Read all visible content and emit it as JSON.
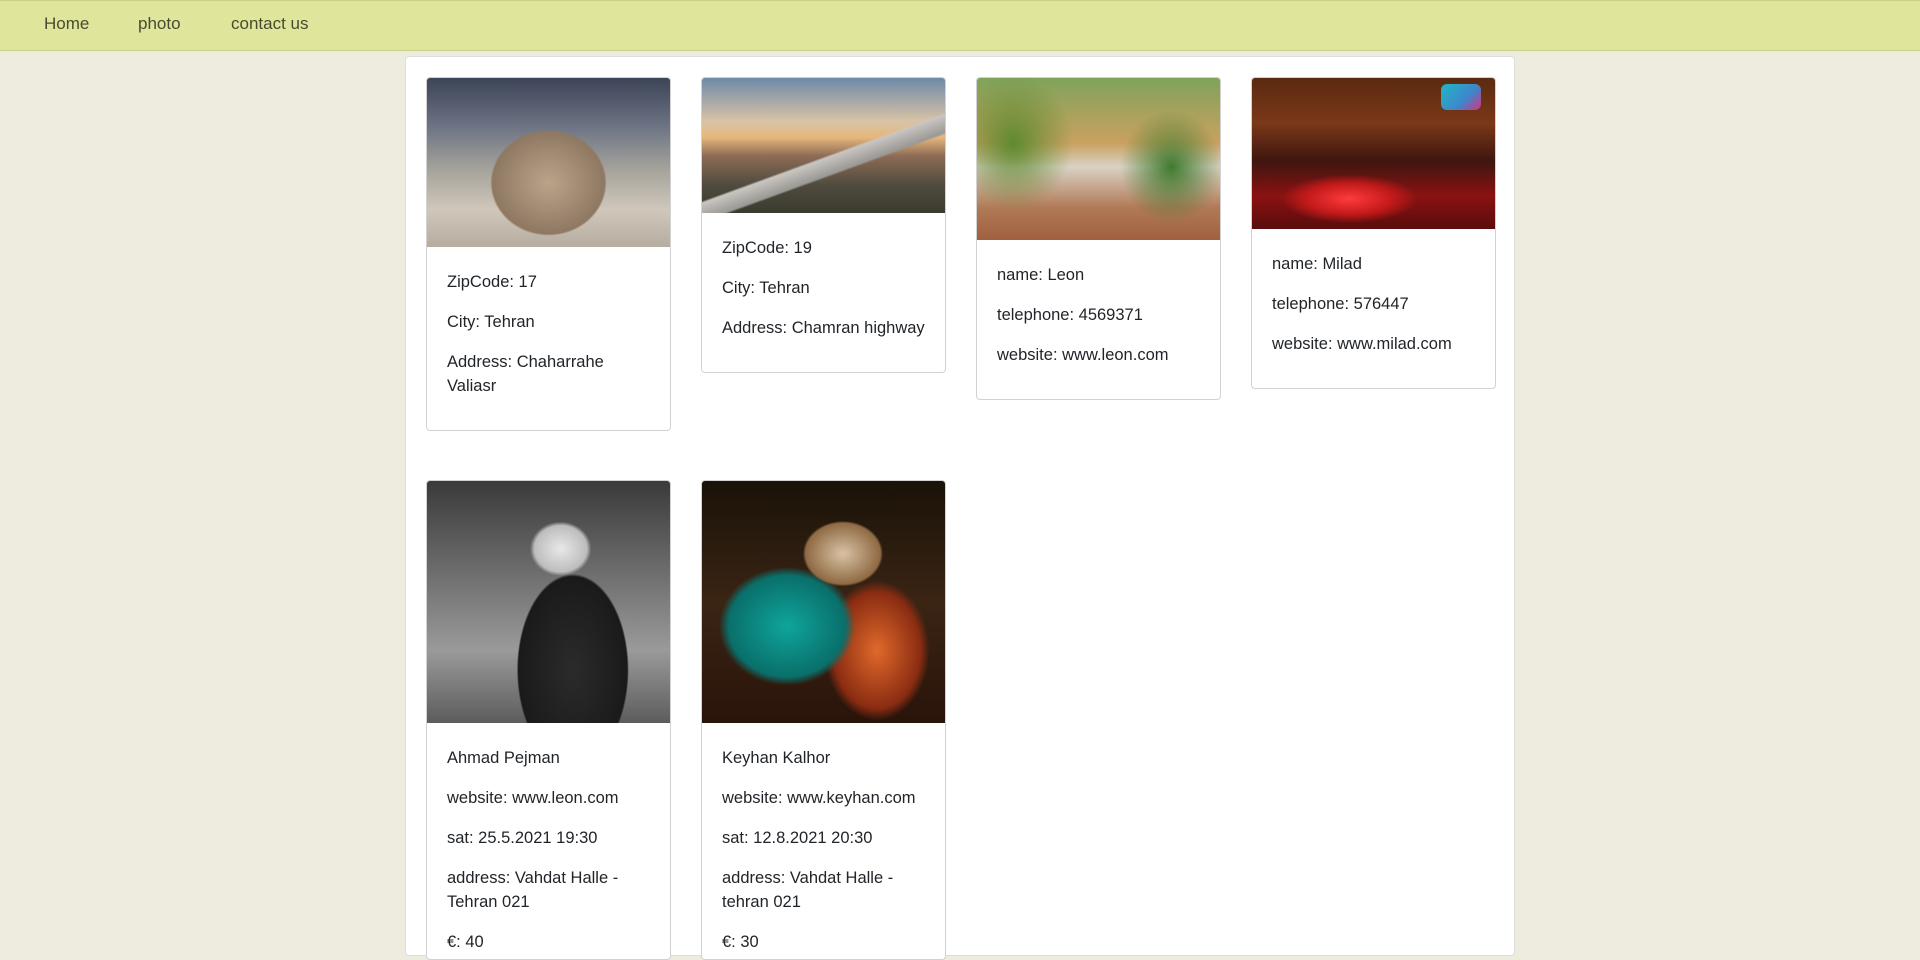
{
  "nav": {
    "items": [
      {
        "label": "Home"
      },
      {
        "label": "photo"
      },
      {
        "label": "contact us"
      }
    ]
  },
  "cards": [
    {
      "image": "tehran-city-theater-photo",
      "lines": [
        "ZipCode: 17",
        "City: Tehran",
        "Address: Chaharrahe Valiasr"
      ]
    },
    {
      "image": "tabiat-bridge-photo",
      "lines": [
        "ZipCode: 19",
        "City: Tehran",
        "Address: Chamran highway"
      ]
    },
    {
      "image": "leon-cafe-photo",
      "lines": [
        "name: Leon",
        "telephone: 4569371",
        "website: www.leon.com"
      ]
    },
    {
      "image": "milad-restaurant-photo",
      "lines": [
        "name: Milad",
        "telephone: 576447",
        "website: www.milad.com"
      ]
    },
    {
      "image": "ahmad-pejman-photo",
      "lines": [
        "Ahmad Pejman",
        "website: www.leon.com",
        "sat: 25.5.2021 19:30",
        "address: Vahdat Halle - Tehran 021",
        "€: 40"
      ]
    },
    {
      "image": "keyhan-kalhor-photo",
      "lines": [
        "Keyhan Kalhor",
        "website: www.keyhan.com",
        "sat: 12.8.2021 20:30",
        "address: Vahdat Halle - tehran 021",
        "€: 30"
      ]
    }
  ]
}
